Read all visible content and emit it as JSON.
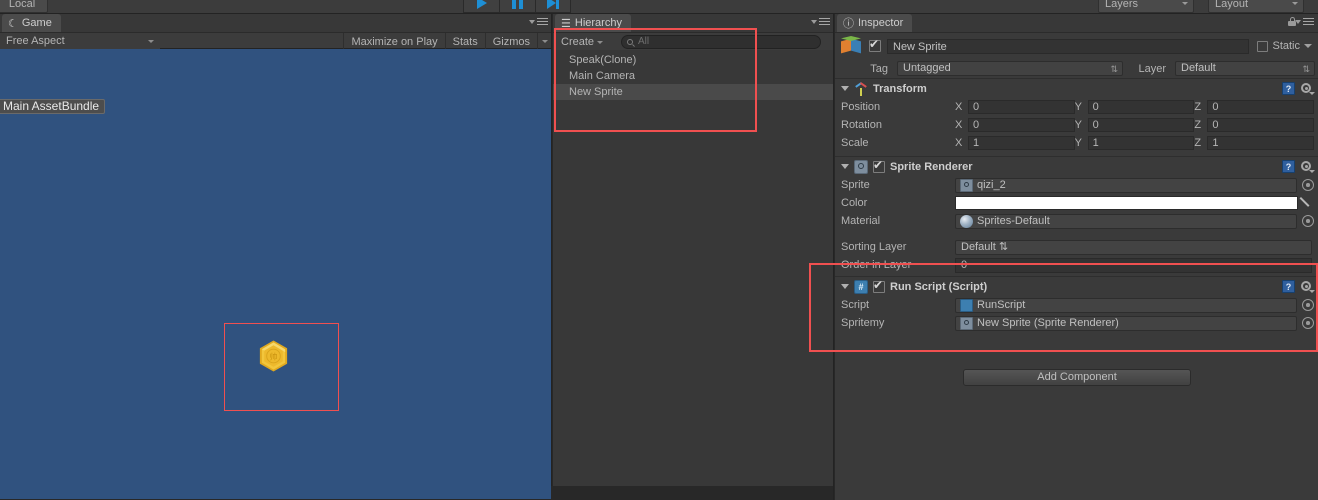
{
  "toolbar": {
    "local_label": "Local",
    "layers_label": "Layers",
    "layout_label": "Layout",
    "play_icon": "play-icon",
    "pause_icon": "pause-icon",
    "step_icon": "step-icon"
  },
  "game_panel": {
    "tab_label": "Game",
    "tab_icon": "game-icon",
    "aspect": "Free Aspect",
    "maximize_on_play": "Maximize on Play",
    "stats": "Stats",
    "gizmos": "Gizmos",
    "viewport_bg": "#30527f",
    "assetbundle_label": "Main AssetBundle",
    "sprite_name": "gold-hex-coin",
    "highlight_color": "#f05050"
  },
  "hierarchy": {
    "tab_label": "Hierarchy",
    "tab_icon": "hierarchy-icon",
    "create_label": "Create",
    "search_value": "All",
    "search_icon": "search-icon",
    "items": [
      {
        "label": "Speak(Clone)",
        "selected": false
      },
      {
        "label": "Main Camera",
        "selected": false
      },
      {
        "label": "New Sprite",
        "selected": true
      }
    ],
    "highlight_color": "#f05050"
  },
  "inspector": {
    "tab_label": "Inspector",
    "tab_icon": "info-icon",
    "lock_icon": "lock-icon",
    "menu_icon": "hamburger-icon",
    "gameobject_icon": "gameobject-cube-icon",
    "enabled": true,
    "object_name": "New Sprite",
    "static_label": "Static",
    "tag_label": "Tag",
    "tag_value": "Untagged",
    "layer_label": "Layer",
    "layer_value": "Default",
    "transform": {
      "title": "Transform",
      "icon": "transform-icon",
      "rows": [
        {
          "label": "Position",
          "x": "0",
          "y": "0",
          "z": "0"
        },
        {
          "label": "Rotation",
          "x": "0",
          "y": "0",
          "z": "0"
        },
        {
          "label": "Scale",
          "x": "1",
          "y": "1",
          "z": "1"
        }
      ],
      "axis_x": "X",
      "axis_y": "Y",
      "axis_z": "Z"
    },
    "sprite_renderer": {
      "title": "Sprite Renderer",
      "icon": "sprite-renderer-icon",
      "enabled": true,
      "sprite_label": "Sprite",
      "sprite_value": "qizi_2",
      "color_label": "Color",
      "color_value": "#ffffff",
      "material_label": "Material",
      "material_value": "Sprites-Default",
      "sorting_layer_label": "Sorting Layer",
      "sorting_layer_value": "Default",
      "order_in_layer_label": "Order in Layer",
      "order_in_layer_value": "0"
    },
    "run_script": {
      "title": "Run Script (Script)",
      "icon": "cs-script-icon",
      "enabled": true,
      "script_label": "Script",
      "script_value": "RunScript",
      "spritemy_label": "Spritemy",
      "spritemy_value": "New Sprite (Sprite Renderer)"
    },
    "add_component_label": "Add Component",
    "highlight_color": "#f05050"
  }
}
